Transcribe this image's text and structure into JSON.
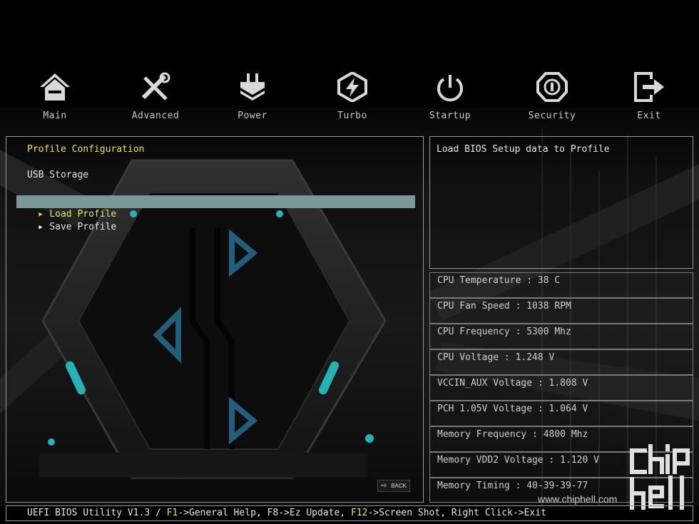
{
  "nav": [
    {
      "label": "Main",
      "icon": "home-icon"
    },
    {
      "label": "Advanced",
      "icon": "tools-icon"
    },
    {
      "label": "Power",
      "icon": "power-plug-icon"
    },
    {
      "label": "Turbo",
      "icon": "lightning-icon"
    },
    {
      "label": "Startup",
      "icon": "power-button-icon"
    },
    {
      "label": "Security",
      "icon": "shield-icon"
    },
    {
      "label": "Exit",
      "icon": "exit-icon"
    }
  ],
  "left": {
    "title": "Profile Configuration",
    "usb": "USB Storage",
    "items": [
      "Load Profile",
      "Save Profile"
    ],
    "selected_index": 0
  },
  "help": "Load BIOS Setup data to Profile",
  "stats": [
    "CPU Temperature : 38 C",
    "CPU Fan Speed : 1038 RPM",
    "CPU Frequency : 5300 Mhz",
    "CPU Voltage : 1.248 V",
    "VCCIN_AUX Voltage : 1.808 V",
    "PCH 1.05V Voltage : 1.064 V",
    "Memory Frequency : 4800 Mhz",
    "Memory VDD2 Voltage : 1.120 V",
    "Memory Timing : 40-39-39-77"
  ],
  "bottom": {
    "prefix": "UEFI BIOS Utility V1.3 / ",
    "f1": "F1",
    "f1_action": "->General Help, F8->Ez Update, ",
    "f12": "F12",
    "f12_action": "->Screen Shot, Right Click->Exit"
  },
  "back_button": "BACK",
  "watermark": {
    "url": "www.chiphell.com"
  },
  "colors": {
    "accent_yellow": "#f2e05a",
    "selected_bg": "#7a9898",
    "border": "#9a9a9a",
    "teal": "#2fd0d8"
  }
}
